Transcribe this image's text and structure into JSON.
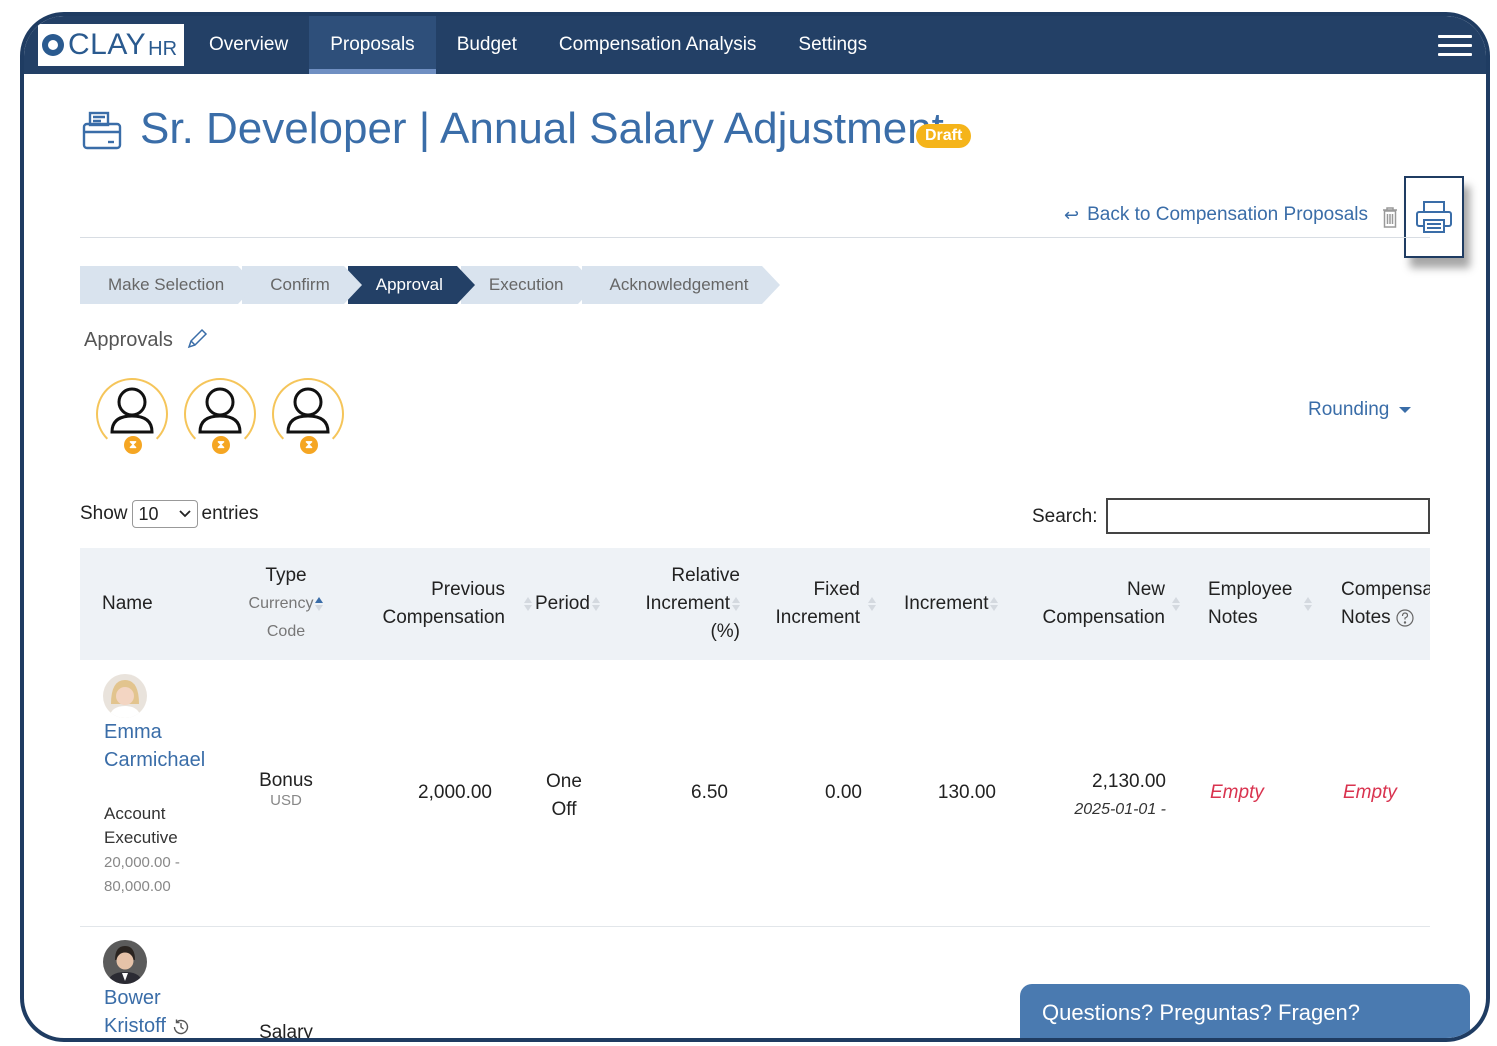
{
  "brand": {
    "main": "CLAY",
    "sub": "HR"
  },
  "nav": {
    "items": [
      "Overview",
      "Proposals",
      "Budget",
      "Compensation Analysis",
      "Settings"
    ],
    "active_index": 1
  },
  "page": {
    "title": "Sr. Developer | Annual Salary Adjustment",
    "status_badge": "Draft",
    "back_link": "Back to Compensation Proposals"
  },
  "steps": [
    "Make Selection",
    "Confirm",
    "Approval",
    "Execution",
    "Acknowledgement"
  ],
  "active_step": "Approval",
  "approvals": {
    "label": "Approvals",
    "approver_count": 3
  },
  "rounding": {
    "label": "Rounding"
  },
  "table_controls": {
    "show_label": "Show",
    "entries_value": "10",
    "entries_label": "entries",
    "search_label": "Search:",
    "search_value": ""
  },
  "columns": {
    "name": "Name",
    "type": "Type",
    "type_sub1": "Currency",
    "type_sub2": "Code",
    "prev_comp_1": "Previous",
    "prev_comp_2": "Compensation",
    "period": "Period",
    "rel_inc_1": "Relative",
    "rel_inc_2": "Increment",
    "rel_inc_3": "(%)",
    "fixed_inc_1": "Fixed",
    "fixed_inc_2": "Increment",
    "increment": "Increment",
    "new_comp_1": "New",
    "new_comp_2": "Compensation",
    "emp_notes_1": "Employee",
    "emp_notes_2": "Notes",
    "comp_notes_1": "Compensa",
    "comp_notes_2": "Notes"
  },
  "rows": [
    {
      "first_name": "Emma",
      "last_name": "Carmichael",
      "job_1": "Account",
      "job_2": "Executive",
      "range_1": "20,000.00 -",
      "range_2": "80,000.00",
      "type": "Bonus",
      "currency": "USD",
      "previous_compensation": "2,000.00",
      "period_1": "One",
      "period_2": "Off",
      "relative_increment": "6.50",
      "fixed_increment": "0.00",
      "increment": "130.00",
      "new_compensation": "2,130.00",
      "effective": "2025-01-01 -",
      "employee_notes": "Empty",
      "compensation_notes": "Empty"
    },
    {
      "first_name": "Bower",
      "last_name": "Kristoff",
      "type": "Salary"
    }
  ],
  "chat": {
    "label": "Questions? Preguntas? Fragen?"
  },
  "colors": {
    "nav_bg": "#234066",
    "accent": "#3a6da8",
    "draft": "#f5b41a",
    "empty": "#d9334f"
  }
}
